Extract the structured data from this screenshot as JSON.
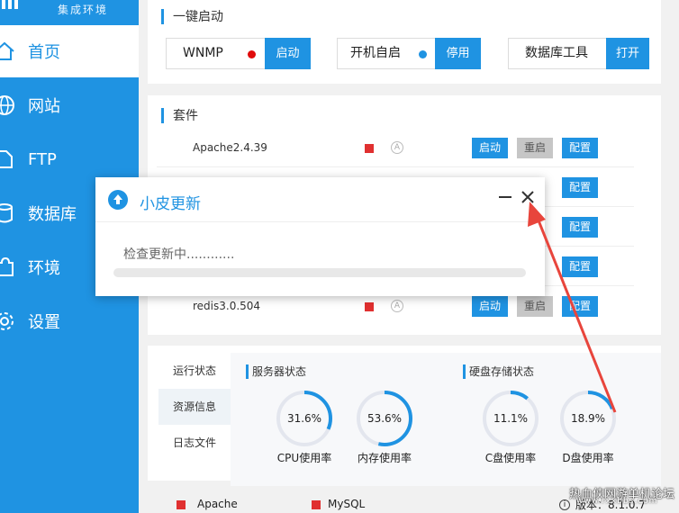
{
  "sidebar": {
    "subtitle": "集成环境",
    "items": [
      {
        "label": "首页",
        "icon": "home-icon"
      },
      {
        "label": "网站",
        "icon": "globe-icon"
      },
      {
        "label": "FTP",
        "icon": "ftp-icon"
      },
      {
        "label": "数据库",
        "icon": "database-icon"
      },
      {
        "label": "环境",
        "icon": "puzzle-icon"
      },
      {
        "label": "设置",
        "icon": "gear-icon"
      }
    ]
  },
  "quick_start": {
    "title": "一键启动",
    "wnmp_label": "WNMP",
    "wnmp_button": "启动",
    "autostart_label": "开机自启",
    "autostart_button": "停用",
    "dbtool_label": "数据库工具",
    "dbtool_button": "打开"
  },
  "suites": {
    "title": "套件",
    "rows": [
      {
        "name": "Apache2.4.39",
        "start": "启动",
        "restart": "重启",
        "config": "配置"
      },
      {
        "name": "",
        "start": "",
        "restart": "",
        "config": "配置"
      },
      {
        "name": "",
        "start": "",
        "restart": "",
        "config": "配置"
      },
      {
        "name": "",
        "start": "",
        "restart": "",
        "config": "配置"
      },
      {
        "name": "redis3.0.504",
        "start": "启动",
        "restart": "重启",
        "config": "配置"
      }
    ]
  },
  "status": {
    "tabs": [
      "运行状态",
      "资源信息",
      "日志文件"
    ],
    "server_title": "服务器状态",
    "disk_title": "硬盘存储状态",
    "gauges": [
      {
        "value": 31.6,
        "text": "31.6%",
        "label": "CPU使用率"
      },
      {
        "value": 53.6,
        "text": "53.6%",
        "label": "内存使用率"
      },
      {
        "value": 11.1,
        "text": "11.1%",
        "label": "C盘使用率"
      },
      {
        "value": 18.9,
        "text": "18.9%",
        "label": "D盘使用率"
      }
    ]
  },
  "footer": {
    "legend1": "Apache",
    "legend2": "MySQL",
    "version": "版本：8.1.0.7"
  },
  "dialog": {
    "title": "小皮更新",
    "message": "检查更新中............",
    "progress": 0
  },
  "watermark": {
    "text": "热血侠网游单机论坛",
    "sub": "www.rxxbbs.com"
  },
  "colors": {
    "accent": "#1f93e2",
    "status_red": "#e03030",
    "status_blue": "#1f93e2",
    "arrow": "#e8453c"
  }
}
